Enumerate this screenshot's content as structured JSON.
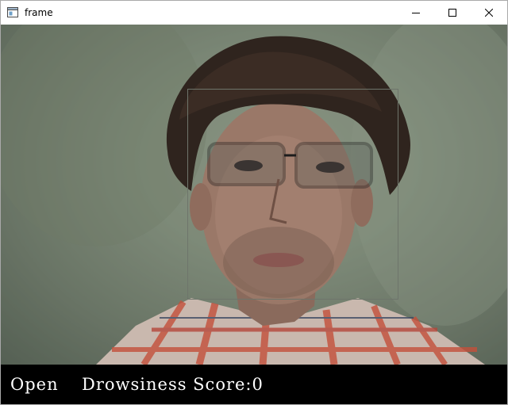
{
  "window": {
    "title": "frame",
    "controls": {
      "minimize_icon": "minimize-icon",
      "maximize_icon": "maximize-icon",
      "close_icon": "close-icon"
    }
  },
  "video": {
    "face_detection_box": true,
    "subject": "webcam image of a person with glasses and plaid shirt"
  },
  "hud": {
    "eye_status": "Open",
    "score_label": "Drowsiness Score:",
    "score_value": "0",
    "text_color": "#ffffff",
    "background_color": "#000000"
  }
}
